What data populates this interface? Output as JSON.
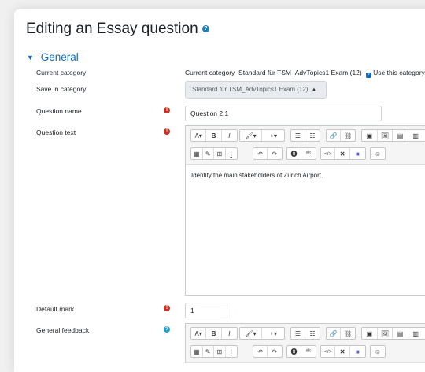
{
  "page": {
    "title": "Editing an Essay question"
  },
  "section": {
    "title": "General"
  },
  "fields": {
    "current_category": {
      "label": "Current category",
      "prefix": "Current category",
      "value": "Standard für TSM_AdvTopics1 Exam (12)",
      "use_label": "Use this category"
    },
    "save_in_category": {
      "label": "Save in category",
      "selected": "Standard für TSM_AdvTopics1 Exam (12)"
    },
    "question_name": {
      "label": "Question name",
      "value": "Question 2.1"
    },
    "question_text": {
      "label": "Question text",
      "content": "Identify the main stakeholders of Zürich Airport."
    },
    "default_mark": {
      "label": "Default mark",
      "value": "1"
    },
    "general_feedback": {
      "label": "General feedback"
    }
  },
  "toolbar": {
    "font": "A▾",
    "bold": "B",
    "italic": "I",
    "brush": "🖌▾",
    "style": "♀▾",
    "ul": "☰",
    "ol": "☷",
    "link": "🔗",
    "unlink": "⛓",
    "media1": "▣",
    "image": "🖼",
    "file1": "▤",
    "file2": "▥",
    "file3": "▦",
    "calc": "▦",
    "edit": "✎",
    "table": "⊞",
    "clear": "I",
    "undo": "↶",
    "redo": "↷",
    "access": "⓿",
    "spell": "ᵃᵇᶜ",
    "html": "</>",
    "fullscreen": "✕",
    "teams": "🟪",
    "emoji": "☺"
  },
  "icons": {
    "help": "help-circle-icon",
    "required": "required-exclamation-icon",
    "info": "info-icon",
    "checkbox": "checkbox-checked-icon",
    "caret": "caret-down-icon"
  }
}
